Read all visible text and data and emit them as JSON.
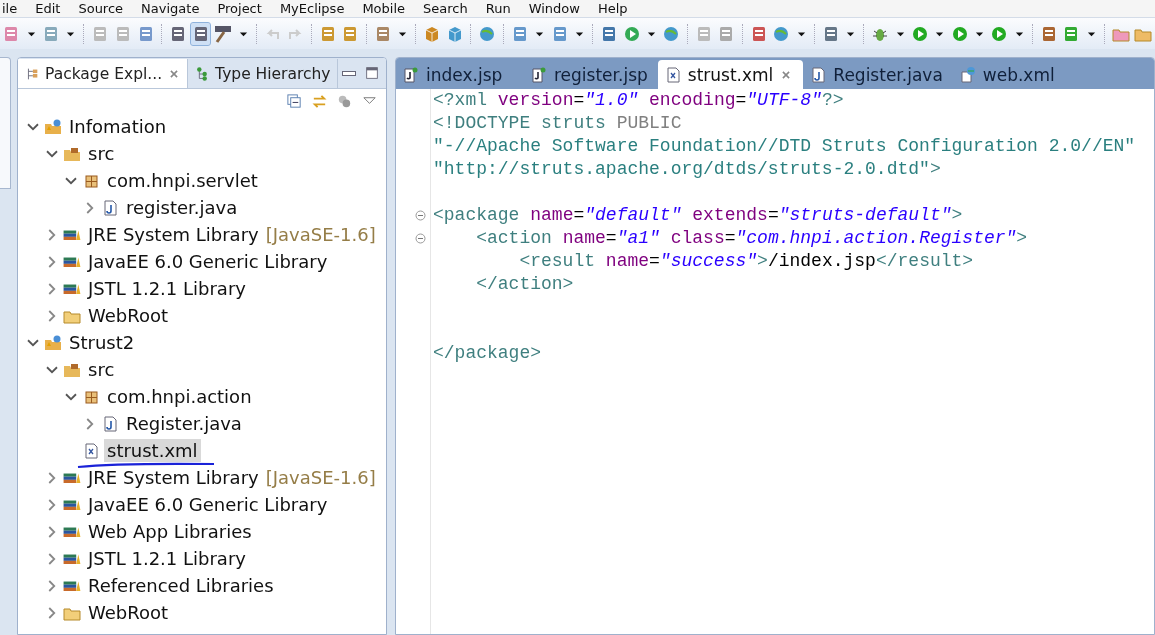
{
  "menu": [
    "ile",
    "Edit",
    "Source",
    "Navigate",
    "Project",
    "MyEclipse",
    "Mobile",
    "Search",
    "Run",
    "Window",
    "Help"
  ],
  "explorer": {
    "tabs": [
      {
        "label": "Package Expl...",
        "kind": "packages",
        "selected": true
      },
      {
        "label": "Type Hierarchy",
        "kind": "hierarchy",
        "selected": false
      }
    ],
    "tree": [
      {
        "label": "Infomation",
        "kind": "project",
        "expanded": true,
        "selected": false,
        "children": [
          {
            "label": "src",
            "kind": "source",
            "expanded": true,
            "selected": false,
            "children": [
              {
                "label": "com.hnpi.servlet",
                "kind": "package",
                "expanded": true,
                "selected": false,
                "children": [
                  {
                    "label": "register.java",
                    "kind": "java",
                    "expanded": false,
                    "selected": false
                  }
                ]
              }
            ]
          },
          {
            "label": "JRE System Library",
            "decoration": "[JavaSE-1.6]",
            "kind": "library",
            "expanded": false,
            "selected": false
          },
          {
            "label": "JavaEE 6.0 Generic Library",
            "kind": "library",
            "expanded": false,
            "selected": false
          },
          {
            "label": "JSTL 1.2.1 Library",
            "kind": "library",
            "expanded": false,
            "selected": false
          },
          {
            "label": "WebRoot",
            "kind": "folder",
            "expanded": false,
            "selected": false
          }
        ]
      },
      {
        "label": "Strust2",
        "kind": "project",
        "expanded": true,
        "selected": false,
        "children": [
          {
            "label": "src",
            "kind": "source",
            "expanded": true,
            "selected": false,
            "children": [
              {
                "label": "com.hnpi.action",
                "kind": "package",
                "expanded": true,
                "selected": false,
                "children": [
                  {
                    "label": "Register.java",
                    "kind": "java",
                    "expanded": false,
                    "selected": false
                  }
                ]
              },
              {
                "label": "strust.xml",
                "kind": "xml",
                "selected": true,
                "underlined": true
              }
            ]
          },
          {
            "label": "JRE System Library",
            "decoration": "[JavaSE-1.6]",
            "kind": "library",
            "expanded": false,
            "selected": false
          },
          {
            "label": "JavaEE 6.0 Generic Library",
            "kind": "library",
            "expanded": false,
            "selected": false
          },
          {
            "label": "Web App Libraries",
            "kind": "library",
            "expanded": false,
            "selected": false
          },
          {
            "label": "JSTL 1.2.1 Library",
            "kind": "library",
            "expanded": false,
            "selected": false
          },
          {
            "label": "Referenced Libraries",
            "kind": "library",
            "expanded": false,
            "selected": false
          },
          {
            "label": "WebRoot",
            "kind": "folder",
            "expanded": false,
            "selected": false
          }
        ]
      }
    ]
  },
  "editor": {
    "tabs": [
      {
        "label": "index.jsp",
        "kind": "jsp",
        "selected": false
      },
      {
        "label": "register.jsp",
        "kind": "jsp",
        "selected": false
      },
      {
        "label": "strust.xml",
        "kind": "xml",
        "selected": true
      },
      {
        "label": "Register.java",
        "kind": "java",
        "selected": false
      },
      {
        "label": "web.xml",
        "kind": "webxml",
        "selected": false
      }
    ],
    "lines": [
      {
        "foldable": false,
        "tokens": [
          {
            "kind": "tag",
            "text": "<?xml"
          },
          {
            "kind": "attr",
            "text": " version"
          },
          {
            "kind": "text",
            "text": "="
          },
          {
            "kind": "value",
            "text": "\"1.0\""
          },
          {
            "kind": "attr",
            "text": " encoding"
          },
          {
            "kind": "text",
            "text": "="
          },
          {
            "kind": "value",
            "text": "\"UTF-8\""
          },
          {
            "kind": "tag",
            "text": "?>"
          }
        ]
      },
      {
        "foldable": false,
        "tokens": [
          {
            "kind": "tag",
            "text": "<!DOCTYPE struts"
          },
          {
            "kind": "keyword",
            "text": " PUBLIC"
          }
        ]
      },
      {
        "foldable": false,
        "tokens": [
          {
            "kind": "pubid",
            "text": "\"-//Apache Software Foundation//DTD Struts Configuration 2.0//EN\""
          }
        ]
      },
      {
        "foldable": false,
        "tokens": [
          {
            "kind": "pubid",
            "text": "\"http://struts.apache.org/dtds/struts-2.0.dtd\""
          },
          {
            "kind": "tag",
            "text": ">"
          }
        ]
      },
      {
        "foldable": false
      },
      {
        "foldable": true,
        "tokens": [
          {
            "kind": "tag",
            "text": "<package"
          },
          {
            "kind": "attr",
            "text": " name"
          },
          {
            "kind": "text",
            "text": "="
          },
          {
            "kind": "value",
            "text": "\"default\""
          },
          {
            "kind": "attr",
            "text": " extends"
          },
          {
            "kind": "text",
            "text": "="
          },
          {
            "kind": "value",
            "text": "\"struts-default\""
          },
          {
            "kind": "tag",
            "text": ">"
          }
        ]
      },
      {
        "foldable": true,
        "tokens": [
          {
            "kind": "tag",
            "text": "    <action"
          },
          {
            "kind": "attr",
            "text": " name"
          },
          {
            "kind": "text",
            "text": "="
          },
          {
            "kind": "value",
            "text": "\"a1\""
          },
          {
            "kind": "attr",
            "text": " class"
          },
          {
            "kind": "text",
            "text": "="
          },
          {
            "kind": "value",
            "text": "\"com.hnpi.action.Register\""
          },
          {
            "kind": "tag",
            "text": ">"
          }
        ]
      },
      {
        "foldable": false,
        "tokens": [
          {
            "kind": "tag",
            "text": "        <result"
          },
          {
            "kind": "attr",
            "text": " name"
          },
          {
            "kind": "text",
            "text": "="
          },
          {
            "kind": "value",
            "text": "\"success\""
          },
          {
            "kind": "tag",
            "text": ">"
          },
          {
            "kind": "text",
            "text": "/index.jsp"
          },
          {
            "kind": "tag",
            "text": "</result>"
          }
        ]
      },
      {
        "foldable": false,
        "tokens": [
          {
            "kind": "tag",
            "text": "    </action>"
          }
        ]
      },
      {
        "foldable": false
      },
      {
        "foldable": false
      },
      {
        "foldable": false,
        "tokens": [
          {
            "kind": "tag",
            "text": "</package>"
          }
        ]
      }
    ]
  }
}
